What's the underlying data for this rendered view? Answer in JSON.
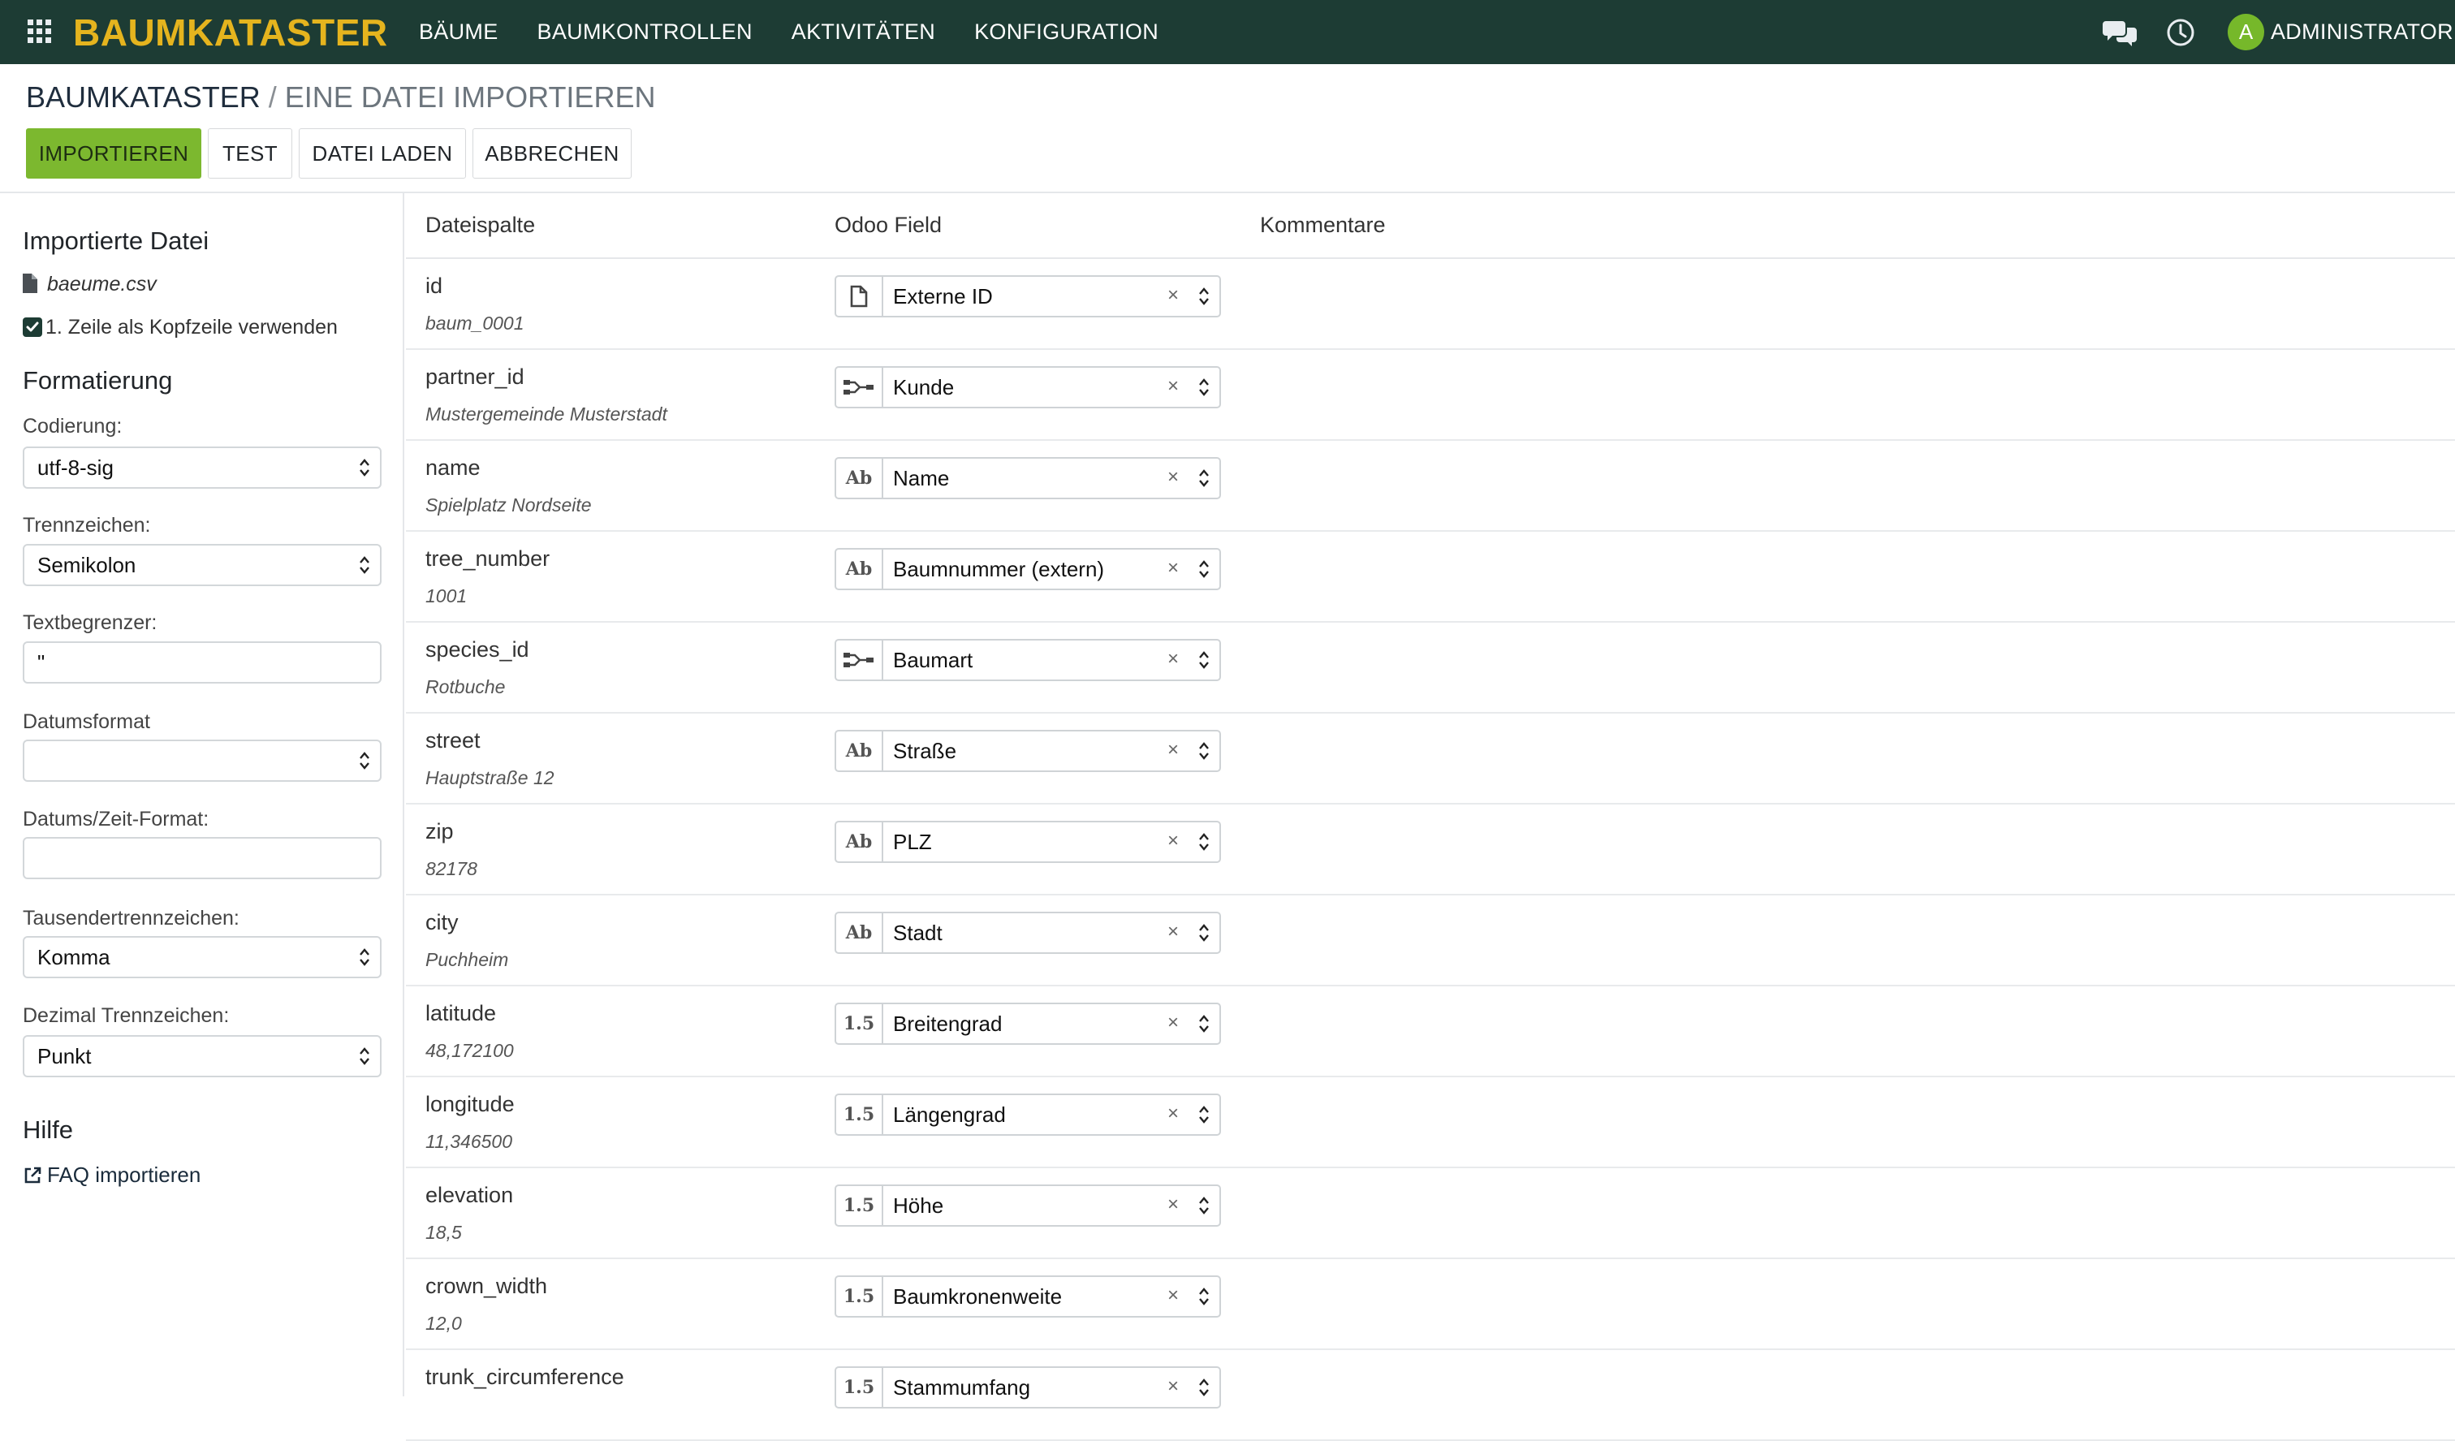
{
  "navbar": {
    "brand": "BAUMKATASTER",
    "menu": [
      "BÄUME",
      "BAUMKONTROLLEN",
      "AKTIVITÄTEN",
      "KONFIGURATION"
    ],
    "user_initial": "A",
    "user_name": "ADMINISTRATOR"
  },
  "breadcrumb": {
    "root": "BAUMKATASTER",
    "separator": "/",
    "current": "EINE DATEI IMPORTIEREN"
  },
  "buttons": {
    "import": "IMPORTIEREN",
    "test": "TEST",
    "load": "DATEI LADEN",
    "cancel": "ABBRECHEN"
  },
  "sidebar": {
    "imported_title": "Importierte Datei",
    "file_name": "baeume.csv",
    "header_checkbox": "1. Zeile als Kopfzeile verwenden",
    "format_title": "Formatierung",
    "encoding_label": "Codierung:",
    "encoding_value": "utf-8-sig",
    "separator_label": "Trennzeichen:",
    "separator_value": "Semikolon",
    "quote_label": "Textbegrenzer:",
    "quote_value": "\"",
    "date_label": "Datumsformat",
    "date_value": "",
    "datetime_label": "Datums/Zeit-Format:",
    "datetime_value": "",
    "thousands_label": "Tausendertrennzeichen:",
    "thousands_value": "Komma",
    "decimal_label": "Dezimal Trennzeichen:",
    "decimal_value": "Punkt",
    "help_title": "Hilfe",
    "faq_link": "FAQ importieren"
  },
  "table": {
    "headers": {
      "column": "Dateispalte",
      "field": "Odoo Field",
      "comments": "Kommentare"
    },
    "rows": [
      {
        "name": "id",
        "sample": "baum_0001",
        "type_icon": "document-icon",
        "type_label": "",
        "field": "Externe ID"
      },
      {
        "name": "partner_id",
        "sample": "Mustergemeinde Musterstadt",
        "type_icon": "relation-icon",
        "type_label": "",
        "field": "Kunde"
      },
      {
        "name": "name",
        "sample": "Spielplatz Nordseite",
        "type_icon": "text-type-icon",
        "type_label": "Ab",
        "field": "Name"
      },
      {
        "name": "tree_number",
        "sample": "1001",
        "type_icon": "text-type-icon",
        "type_label": "Ab",
        "field": "Baumnummer (extern)"
      },
      {
        "name": "species_id",
        "sample": "Rotbuche",
        "type_icon": "relation-icon",
        "type_label": "",
        "field": "Baumart"
      },
      {
        "name": "street",
        "sample": "Hauptstraße 12",
        "type_icon": "text-type-icon",
        "type_label": "Ab",
        "field": "Straße"
      },
      {
        "name": "zip",
        "sample": "82178",
        "type_icon": "text-type-icon",
        "type_label": "Ab",
        "field": "PLZ"
      },
      {
        "name": "city",
        "sample": "Puchheim",
        "type_icon": "text-type-icon",
        "type_label": "Ab",
        "field": "Stadt"
      },
      {
        "name": "latitude",
        "sample": "48,172100",
        "type_icon": "float-type-icon",
        "type_label": "1.5",
        "field": "Breitengrad"
      },
      {
        "name": "longitude",
        "sample": "11,346500",
        "type_icon": "float-type-icon",
        "type_label": "1.5",
        "field": "Längengrad"
      },
      {
        "name": "elevation",
        "sample": "18,5",
        "type_icon": "float-type-icon",
        "type_label": "1.5",
        "field": "Höhe"
      },
      {
        "name": "crown_width",
        "sample": "12,0",
        "type_icon": "float-type-icon",
        "type_label": "1.5",
        "field": "Baumkronenweite"
      },
      {
        "name": "trunk_circumference",
        "sample": "",
        "type_icon": "float-type-icon",
        "type_label": "1.5",
        "field": "Stammumfang"
      }
    ]
  },
  "colors": {
    "navbar": "#1d3c34",
    "brand": "#e5b41e",
    "primary": "#7cb82f",
    "avatar": "#76b82a"
  }
}
